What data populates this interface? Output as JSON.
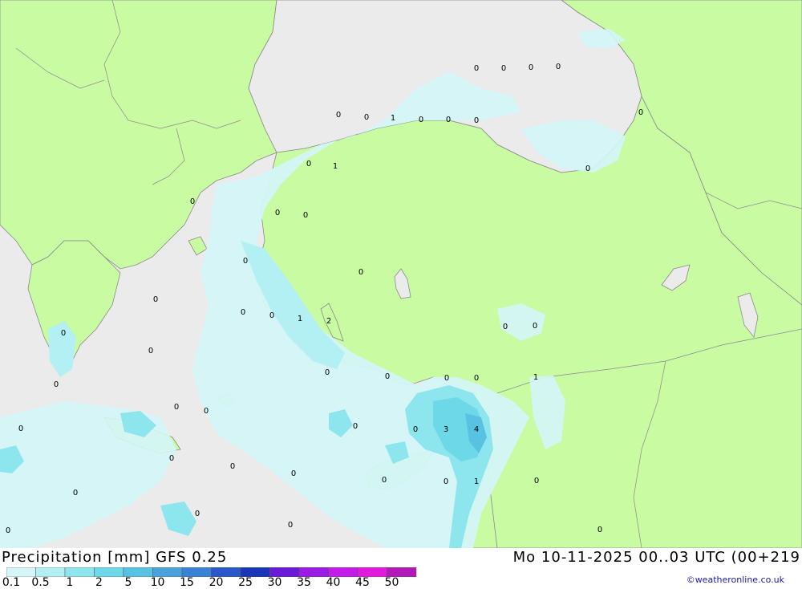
{
  "title": "Precipitation [mm] GFS 0.25",
  "datetime": "Mo 10-11-2025 00..03 UTC (00+219",
  "credit": "©weatheronline.co.uk",
  "colors": {
    "sea": "#ebebeb",
    "land": "#c8fba2",
    "border": "#8a8a8a"
  },
  "legend": {
    "labels": [
      "0.1",
      "0.5",
      "1",
      "2",
      "5",
      "10",
      "15",
      "20",
      "25",
      "30",
      "35",
      "40",
      "45",
      "50"
    ],
    "colors": [
      "#d4f6f8",
      "#b2f0f4",
      "#8de6ee",
      "#6cd8e8",
      "#58c2e2",
      "#4aa2dc",
      "#3a82d8",
      "#2a58cc",
      "#1a36b8",
      "#6a1ad8",
      "#9a1ae6",
      "#c41aea",
      "#e21ae0",
      "#b218b8"
    ]
  },
  "value_labels": [
    "0",
    "0",
    "0",
    "0",
    "0",
    "0",
    "1",
    "0",
    "0",
    "0",
    "0",
    "0",
    "1",
    "0",
    "0",
    "0",
    "0",
    "0",
    "0",
    "0",
    "0",
    "1",
    "2",
    "0",
    "0",
    "0",
    "0",
    "1",
    "0",
    "0",
    "0",
    "0",
    "0",
    "0",
    "0",
    "0",
    "3",
    "4",
    "0",
    "0",
    "0",
    "0",
    "1",
    "0",
    "0",
    "0",
    "0",
    "0",
    "0",
    "0",
    "0",
    "0",
    "0"
  ]
}
